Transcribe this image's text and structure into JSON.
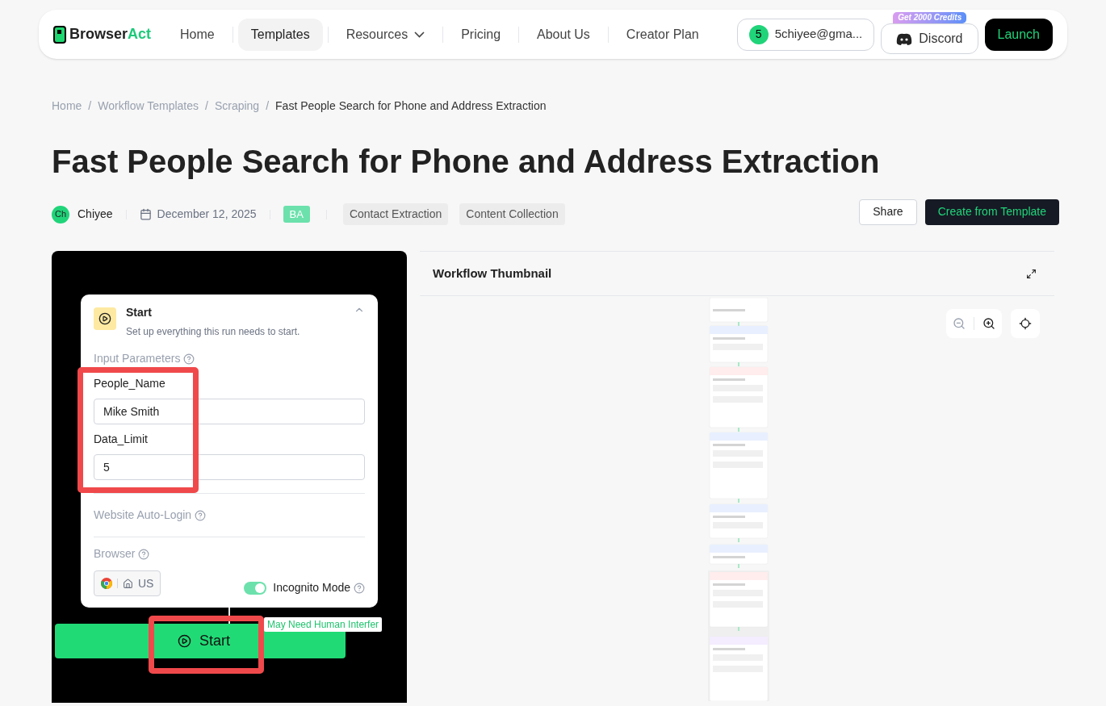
{
  "nav": {
    "logo": {
      "part1": "Browser",
      "part2": "Act"
    },
    "links": [
      {
        "label": "Home",
        "selected": false,
        "kind": "link"
      },
      {
        "label": "Templates",
        "selected": true,
        "kind": "link"
      },
      {
        "label": "Resources",
        "selected": false,
        "kind": "dropdown"
      },
      {
        "label": "Pricing",
        "selected": false,
        "kind": "link"
      },
      {
        "label": "About Us",
        "selected": false,
        "kind": "link"
      },
      {
        "label": "Creator Plan",
        "selected": false,
        "kind": "link"
      }
    ],
    "account": {
      "avatar": "5",
      "email": "5chiyee@gma..."
    },
    "discord": {
      "label": "Discord",
      "badge": "Get 2000 Credits"
    },
    "launch": "Launch"
  },
  "breadcrumb": {
    "separator": "/",
    "items": [
      "Home",
      "Workflow Templates",
      "Scraping",
      "Fast People Search for Phone and Address Extraction"
    ]
  },
  "title": "Fast People Search for Phone and Address Extraction",
  "meta": {
    "author_initials": "Ch",
    "author": "Chiyee",
    "date": "December 12, 2025",
    "badge": "BA",
    "tags": [
      "Contact Extraction",
      "Content Collection"
    ]
  },
  "actions": {
    "share": "Share",
    "create": "Create from Template"
  },
  "start_card": {
    "title": "Start",
    "subtitle": "Set up everything this run needs to start.",
    "input_parameters_label": "Input Parameters",
    "fields": [
      {
        "label": "People_Name",
        "value": "Mike Smith"
      },
      {
        "label": "Data_Limit",
        "value": "5"
      }
    ],
    "auto_login_label": "Website Auto-Login",
    "browser_label": "Browser",
    "region": "US",
    "incognito": {
      "label": "Incognito Mode",
      "on": true
    }
  },
  "start_button": "Start",
  "warning_tag": "May Need Human Interfer",
  "thumbnail": {
    "title": "Workflow Thumbnail"
  }
}
